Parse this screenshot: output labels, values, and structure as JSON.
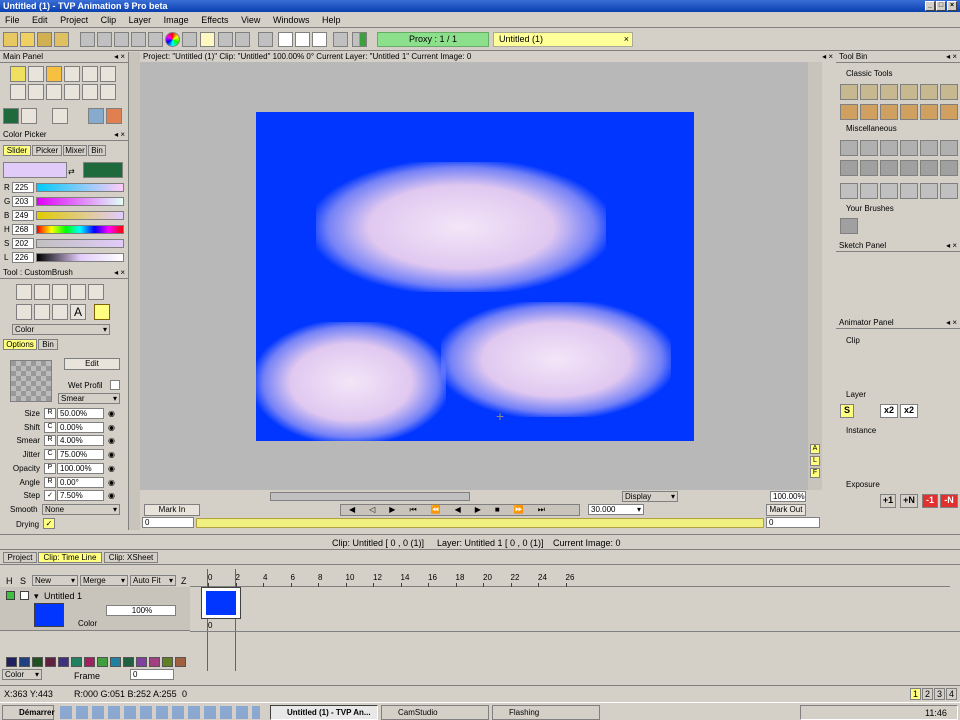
{
  "window": {
    "title": "Untitled (1) - TVP Animation 9 Pro beta"
  },
  "menu": [
    "File",
    "Edit",
    "Project",
    "Clip",
    "Layer",
    "Image",
    "Effects",
    "View",
    "Windows",
    "Help"
  ],
  "toolbar": {
    "proxy": "Proxy : 1 / 1",
    "clip_tab": "Untitled (1)"
  },
  "main_panel": {
    "title": "Main Panel"
  },
  "color_picker": {
    "title": "Color Picker",
    "tabs": [
      "Slider",
      "Picker",
      "Mixer",
      "Bin"
    ],
    "rows": [
      {
        "label": "R",
        "value": "225"
      },
      {
        "label": "G",
        "value": "203"
      },
      {
        "label": "B",
        "value": "249"
      },
      {
        "label": "H",
        "value": "268"
      },
      {
        "label": "S",
        "value": "202"
      },
      {
        "label": "L",
        "value": "226"
      }
    ],
    "primary_color": "#e1cbf9",
    "secondary_color": "#1e6a3c"
  },
  "tool_panel": {
    "title": "Tool : CustomBrush",
    "color_select": "Color",
    "tabs": [
      "Options",
      "Bin"
    ],
    "edit": "Edit",
    "wet_profil": "Wet Profil",
    "mode": "Smear",
    "params": [
      {
        "label": "Size",
        "flag": "R",
        "value": "50.00%"
      },
      {
        "label": "Shift",
        "flag": "C",
        "value": "0.00%"
      },
      {
        "label": "Smear",
        "flag": "R",
        "value": "4.00%"
      },
      {
        "label": "Jitter",
        "flag": "C",
        "value": "75.00%"
      },
      {
        "label": "Opacity",
        "flag": "P",
        "value": "100.00%"
      },
      {
        "label": "Angle",
        "flag": "R",
        "value": "0.00°"
      },
      {
        "label": "Step",
        "flag": "✓",
        "value": "7.50%"
      }
    ],
    "smooth_label": "Smooth",
    "smooth_value": "None",
    "drying_label": "Drying"
  },
  "project_bar": "Project: \"Untitled (1)\"  Clip: \"Untitled\"   100.00%   0°   Current Layer: \"Untitled 1\"   Current Image: 0",
  "canvas_controls": {
    "display": "Display",
    "zoom": "100.00%",
    "mark_in": "Mark In",
    "mark_out": "Mark Out",
    "fps": "30.000",
    "frame_in": "0",
    "frame_out": "0"
  },
  "tool_bin": {
    "title": "Tool Bin",
    "sections": [
      "Classic Tools",
      "Miscellaneous",
      "Your Brushes"
    ]
  },
  "sketch_panel": {
    "title": "Sketch Panel"
  },
  "animator_panel": {
    "title": "Animator Panel",
    "sections": [
      "Clip",
      "Layer",
      "Instance",
      "Exposure"
    ],
    "buttons": [
      "S",
      "x2",
      "x2",
      "+1",
      "+N",
      "-1",
      "-N"
    ]
  },
  "status_bar": {
    "clip": "Clip: Untitled [ 0 , 0  (1)]",
    "layer": "Layer: Untitled 1 [ 0 , 0  (1)]",
    "image": "Current Image: 0"
  },
  "bottom_tabs": [
    "Project",
    "Clip: Time Line",
    "Clip: XSheet"
  ],
  "timeline": {
    "headers": {
      "h": "H",
      "s": "S",
      "new": "New",
      "merge": "Merge",
      "autofit": "Auto Fit",
      "z": "Z"
    },
    "ruler": [
      "0",
      "2",
      "4",
      "6",
      "8",
      "10",
      "12",
      "14",
      "16",
      "18",
      "20",
      "22",
      "24",
      "26"
    ],
    "layer_name": "Untitled 1",
    "layer_opacity": "100%",
    "layer_mode": "Color",
    "cell_index": "0",
    "bottom_color": "Color",
    "bottom_frame": "Frame",
    "bottom_frame_value": "0",
    "swatches": [
      "#202060",
      "#204080",
      "#205020",
      "#602040",
      "#403080",
      "#208060",
      "#a02060",
      "#40a040",
      "#2080a0",
      "#206040",
      "#8040a0",
      "#a04080",
      "#608020",
      "#a06040"
    ]
  },
  "info_bar": {
    "coords": "X:363  Y:443",
    "rgba": "R:000 G:051 B:252 A:255",
    "value": "0",
    "pages": [
      "1",
      "2",
      "3",
      "4"
    ]
  },
  "taskbar": {
    "start": "Démarrer",
    "tasks": [
      "Untitled (1) - TVP An...",
      "CamStudio",
      "Flashing"
    ],
    "clock": "11:46"
  }
}
